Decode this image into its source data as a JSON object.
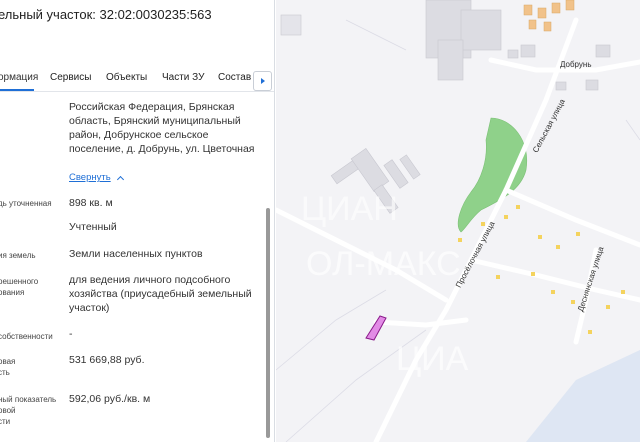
{
  "panel": {
    "title": "ельный участок: 32:02:0030235:563",
    "tabs": [
      {
        "label": "ормация"
      },
      {
        "label": "Сервисы"
      },
      {
        "label": "Объекты"
      },
      {
        "label": "Части ЗУ"
      },
      {
        "label": "Состав"
      }
    ],
    "address": "Российская Федерация, Брянская область, Брянский муниципальный район, Добрунское сельское поселение, д. Добрунь, ул. Цветочная",
    "collapse_label": "Свернуть",
    "fields": [
      {
        "label": "дь уточненная",
        "value": "898 кв. м"
      },
      {
        "label": "",
        "value": "Учтенный"
      },
      {
        "label": "ия земель",
        "value": "Земли населенных пунктов"
      },
      {
        "label": "решенного\nования",
        "value": "для ведения личного подсобного хозяйства (приусадебный земельный участок)"
      },
      {
        "label": "собственности",
        "value": "-"
      },
      {
        "label": "овая\nсть",
        "value": "531 669,88 руб."
      },
      {
        "label": "ный показатель\nовой\nсти",
        "value": "592,06 руб./кв. м"
      }
    ]
  },
  "map": {
    "labels": {
      "village": "Добрунь",
      "street_selskaya": "Сельская улица",
      "street_prosyolochnaya": "Просёлочная улица",
      "street_desnyanskaya": "Деснянская улица",
      "watermark_top": "ЦИАН",
      "watermark_mid": "ОЛ-МАКС",
      "watermark_bottom": "ЦИА"
    },
    "colors": {
      "background": "#f3f3f6",
      "buildings": "#dcdce2",
      "green": "#8fd18a",
      "parcel": "#d94fd9",
      "roads": "#ffffff"
    }
  }
}
